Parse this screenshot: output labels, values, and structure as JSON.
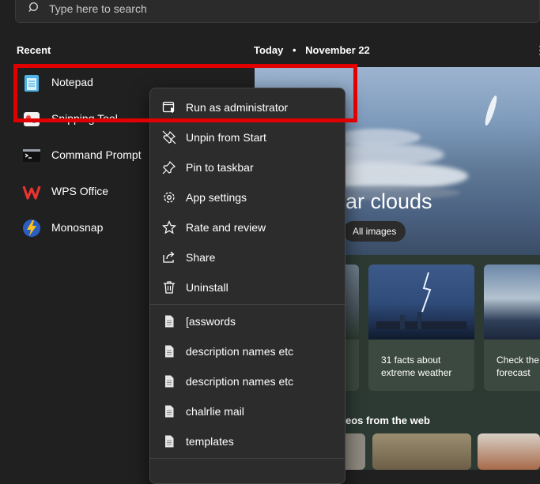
{
  "search": {
    "placeholder": "Type here to search"
  },
  "recent": {
    "title": "Recent",
    "items": [
      {
        "label": "Notepad",
        "icon": "notepad-icon"
      },
      {
        "label": "Snipping Tool",
        "icon": "snipping-tool-icon"
      },
      {
        "label": "Command Prompt",
        "icon": "command-prompt-icon"
      },
      {
        "label": "WPS Office",
        "icon": "wps-office-icon"
      },
      {
        "label": "Monosnap",
        "icon": "monosnap-icon"
      }
    ]
  },
  "today": {
    "title": "Today",
    "separator": "•",
    "date": "November 22",
    "more": "⋮",
    "hero_title": "ar clouds",
    "all_images": "All images",
    "cards": [
      {
        "caption_line1": "31 facts about",
        "caption_line2": "extreme weather"
      },
      {
        "caption_line1": "Check the",
        "caption_line2": "forecast"
      }
    ],
    "web_title": "eos from the web"
  },
  "context_menu": {
    "items": [
      {
        "label": "Run as administrator",
        "icon": "shield-window-icon"
      },
      {
        "label": "Unpin from Start",
        "icon": "unpin-icon"
      },
      {
        "label": "Pin to taskbar",
        "icon": "pin-icon"
      },
      {
        "label": "App settings",
        "icon": "gear-icon"
      },
      {
        "label": "Rate and review",
        "icon": "star-icon"
      },
      {
        "label": "Share",
        "icon": "share-icon"
      },
      {
        "label": "Uninstall",
        "icon": "trash-icon"
      }
    ],
    "files": [
      {
        "label": "[asswords",
        "icon": "document-icon"
      },
      {
        "label": "description names etc",
        "icon": "document-icon"
      },
      {
        "label": "description names etc",
        "icon": "document-icon"
      },
      {
        "label": "chalrlie mail",
        "icon": "document-icon"
      },
      {
        "label": "templates",
        "icon": "document-icon"
      }
    ]
  },
  "colors": {
    "highlight": "#e00000",
    "menu_bg": "#2c2c2c",
    "page_bg": "#202020"
  }
}
